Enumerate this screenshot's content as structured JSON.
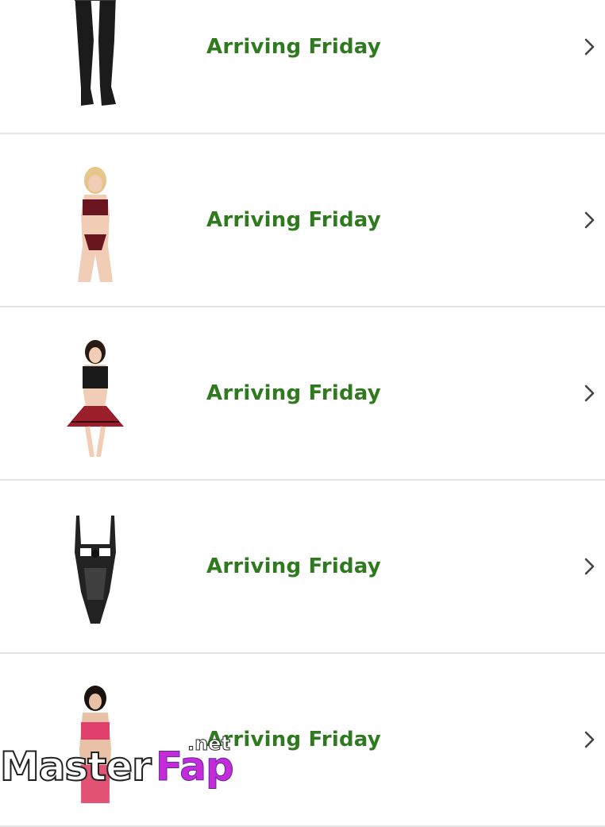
{
  "orders": [
    {
      "status": "Arriving Friday",
      "thumb_icon": "stockings-product-image"
    },
    {
      "status": "Arriving Friday",
      "thumb_icon": "lace-lingerie-set-product-image"
    },
    {
      "status": "Arriving Friday",
      "thumb_icon": "plaid-skirt-set-product-image"
    },
    {
      "status": "Arriving Friday",
      "thumb_icon": "lace-teddy-product-image"
    },
    {
      "status": "Arriving Friday",
      "thumb_icon": "pink-lingerie-set-product-image"
    }
  ],
  "status_color": "#2f7a1f",
  "chevron_icon": "chevron-right-icon",
  "watermark": {
    "part1": "Master",
    "part2": "Fap",
    "part3": ".net"
  }
}
